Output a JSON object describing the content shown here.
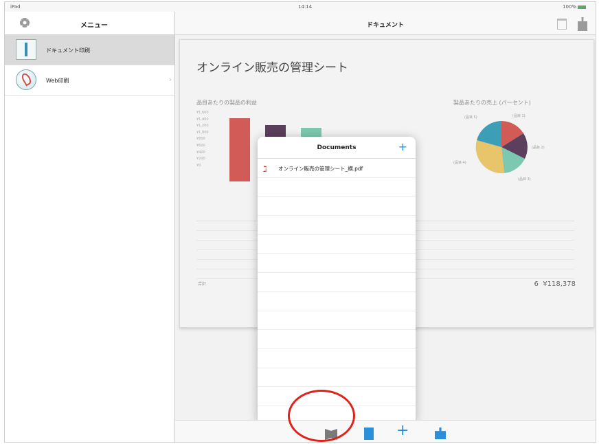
{
  "status": {
    "carrier": "iPad ",
    "time": "14:14",
    "battery": "100%"
  },
  "sidebar": {
    "title": "メニュー",
    "items": [
      {
        "label": "ドキュメント印刷",
        "icon": "document-print-icon",
        "selected": true
      },
      {
        "label": "Web印刷",
        "icon": "globe-icon",
        "selected": false
      }
    ]
  },
  "header": {
    "title": "ドキュメント"
  },
  "document": {
    "title": "オンライン販売の管理シート",
    "bar_chart_title": "品目あたりの製品の利益",
    "pie_chart_title": "製品あたりの売上 (パーセント)",
    "y_ticks": [
      "¥1,600",
      "¥1,400",
      "¥1,200",
      "¥1,000",
      "¥800",
      "¥600",
      "¥400",
      "¥200",
      "¥0"
    ],
    "pie_labels": [
      "(品目 5)",
      "(品目 1)",
      "(品目 2)",
      "(品目 3)",
      "(品目 4)"
    ],
    "total_label": "合計",
    "total_count": "6",
    "total_value": "¥118,378"
  },
  "popover": {
    "title": "Documents",
    "files": [
      "オンライン販売の管理シート_横.pdf"
    ]
  },
  "colors": {
    "accent": "#2b8fd9",
    "highlight": "#e0231a",
    "pdf": "#e0322d"
  }
}
